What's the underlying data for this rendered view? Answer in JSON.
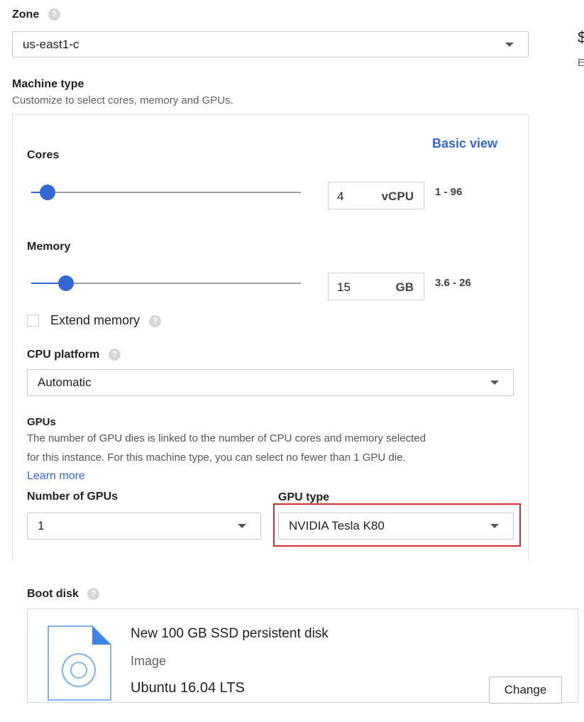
{
  "zone": {
    "label": "Zone",
    "help_icon": "?",
    "value": "us-east1-c"
  },
  "machine_type": {
    "label": "Machine type",
    "subtitle": "Customize to select cores, memory and GPUs.",
    "basic_view_link": "Basic view",
    "cores": {
      "label": "Cores",
      "value": "4",
      "unit": "vCPU",
      "range": "1 - 96",
      "slider_fraction": 0.04
    },
    "memory": {
      "label": "Memory",
      "value": "15",
      "unit": "GB",
      "range": "3.6 - 26",
      "slider_fraction": 0.15
    },
    "extend_memory": {
      "label": "Extend memory",
      "checked": false
    },
    "cpu_platform": {
      "label": "CPU platform",
      "value": "Automatic"
    },
    "gpus": {
      "label": "GPUs",
      "description_line1": "The number of GPU dies is linked to the number of CPU cores and memory selected",
      "description_line2": "for this instance. For this machine type, you can select no fewer than 1 GPU die.",
      "learn_more": "Learn more",
      "count_label": "Number of GPUs",
      "count_value": "1",
      "type_label": "GPU type",
      "type_value": "NVIDIA Tesla K80"
    }
  },
  "right_edge": {
    "heading_fragment": "$",
    "sub_fragment": "E"
  },
  "boot_disk": {
    "label": "Boot disk",
    "title": "New 100 GB SSD persistent disk",
    "image_label": "Image",
    "image_value": "Ubuntu 16.04 LTS",
    "change_button": "Change"
  },
  "colors": {
    "accent": "#3367d6",
    "highlight_border": "#d32f2f"
  }
}
